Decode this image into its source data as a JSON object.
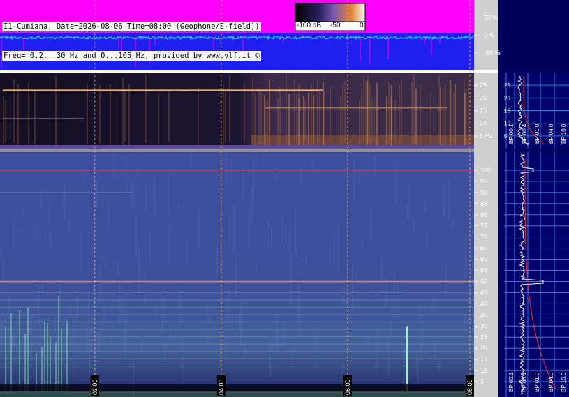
{
  "header": {
    "line1": "I1-Cumiana, Date=2026-08-06 Time=08:00 (Geophone/E-field))",
    "line2": "Freq= 0.2...30 Hz and 0...105 Hz, provided by www.vlf.it ©"
  },
  "colorbar": {
    "labels": [
      "-100 dB",
      "-50",
      "0"
    ]
  },
  "chart_data": [
    {
      "type": "line",
      "panel": "amplitude strip",
      "yticks": [
        "50 %",
        "0 %",
        "-50 %"
      ],
      "ylim": [
        -100,
        100
      ],
      "background": "#1f1ff0",
      "fill_color": "#ff00ff",
      "trace_color": "#33ddff"
    },
    {
      "type": "heatmap",
      "panel": "spectrogram 0.2-30 Hz",
      "yticks": [
        "25",
        "20",
        "15",
        "10",
        "5 Hz"
      ],
      "ylim": [
        0,
        30
      ],
      "hline_hz": [
        23,
        16,
        12
      ],
      "colors": [
        "#000000",
        "#4a3a8a",
        "#e08030",
        "#ffffff"
      ]
    },
    {
      "type": "heatmap",
      "panel": "spectrogram 0-105 Hz",
      "yticks": [
        "100",
        "95",
        "90",
        "85",
        "80",
        "75",
        "70",
        "65",
        "60",
        "55",
        "50",
        "45",
        "40",
        "35",
        "30",
        "25",
        "20",
        "15",
        "10",
        "5"
      ],
      "ylim": [
        0,
        105
      ],
      "hline_hz": [
        100,
        50
      ],
      "xticks": [
        "02:00",
        "04:00",
        "06:00",
        "08:00"
      ],
      "xlim_hours": [
        0.5,
        8
      ],
      "colors": [
        "#3a4a9a",
        "#5a6ab0",
        "#60c0a0",
        "#ffffff"
      ]
    },
    {
      "type": "line",
      "panel": "side spectrum upper",
      "scale_labels": [
        "BP 00.1",
        "BP 00.4",
        "BP 01.0",
        "BP 04.0",
        "BP 10.0"
      ],
      "yticks": [
        "25",
        "20",
        "15",
        "10",
        "5"
      ]
    },
    {
      "type": "line",
      "panel": "side spectrum lower",
      "scale_labels": [
        "BP 00.1",
        "BP 00.4",
        "BP 01.0",
        "BP 04.0",
        "BP 10.0"
      ],
      "peaks_hz": [
        100,
        50
      ]
    }
  ]
}
